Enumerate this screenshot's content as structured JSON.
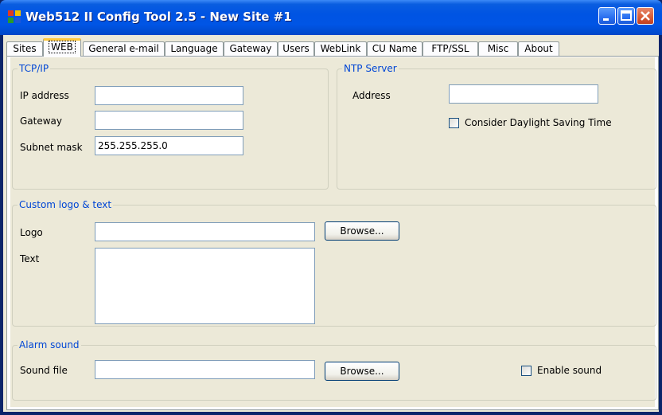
{
  "window": {
    "title": "Web512 II Config Tool 2.5 - New Site #1",
    "controls": [
      "minimize",
      "maximize",
      "close"
    ]
  },
  "tabs": [
    {
      "label": "Sites"
    },
    {
      "label": "WEB"
    },
    {
      "label": "General e-mail"
    },
    {
      "label": "Language"
    },
    {
      "label": "Gateway"
    },
    {
      "label": "Users"
    },
    {
      "label": "WebLink"
    },
    {
      "label": "CU Name"
    },
    {
      "label": "FTP/SSL"
    },
    {
      "label": "Misc"
    },
    {
      "label": "About"
    }
  ],
  "active_tab": "WEB",
  "tcpip": {
    "title": "TCP/IP",
    "ip_label": "IP address",
    "ip_value": "",
    "gateway_label": "Gateway",
    "gateway_value": "",
    "subnet_label": "Subnet mask",
    "subnet_value": "255.255.255.0"
  },
  "ntp": {
    "title": "NTP Server",
    "address_label": "Address",
    "address_value": "",
    "dst_label": "Consider Daylight Saving Time",
    "dst_checked": false
  },
  "custom": {
    "title": "Custom logo & text",
    "logo_label": "Logo",
    "logo_value": "",
    "browse_label": "Browse...",
    "text_label": "Text",
    "text_value": ""
  },
  "alarm": {
    "title": "Alarm sound",
    "sound_label": "Sound file",
    "sound_value": "",
    "browse_label": "Browse...",
    "enable_label": "Enable sound",
    "enable_checked": false
  }
}
